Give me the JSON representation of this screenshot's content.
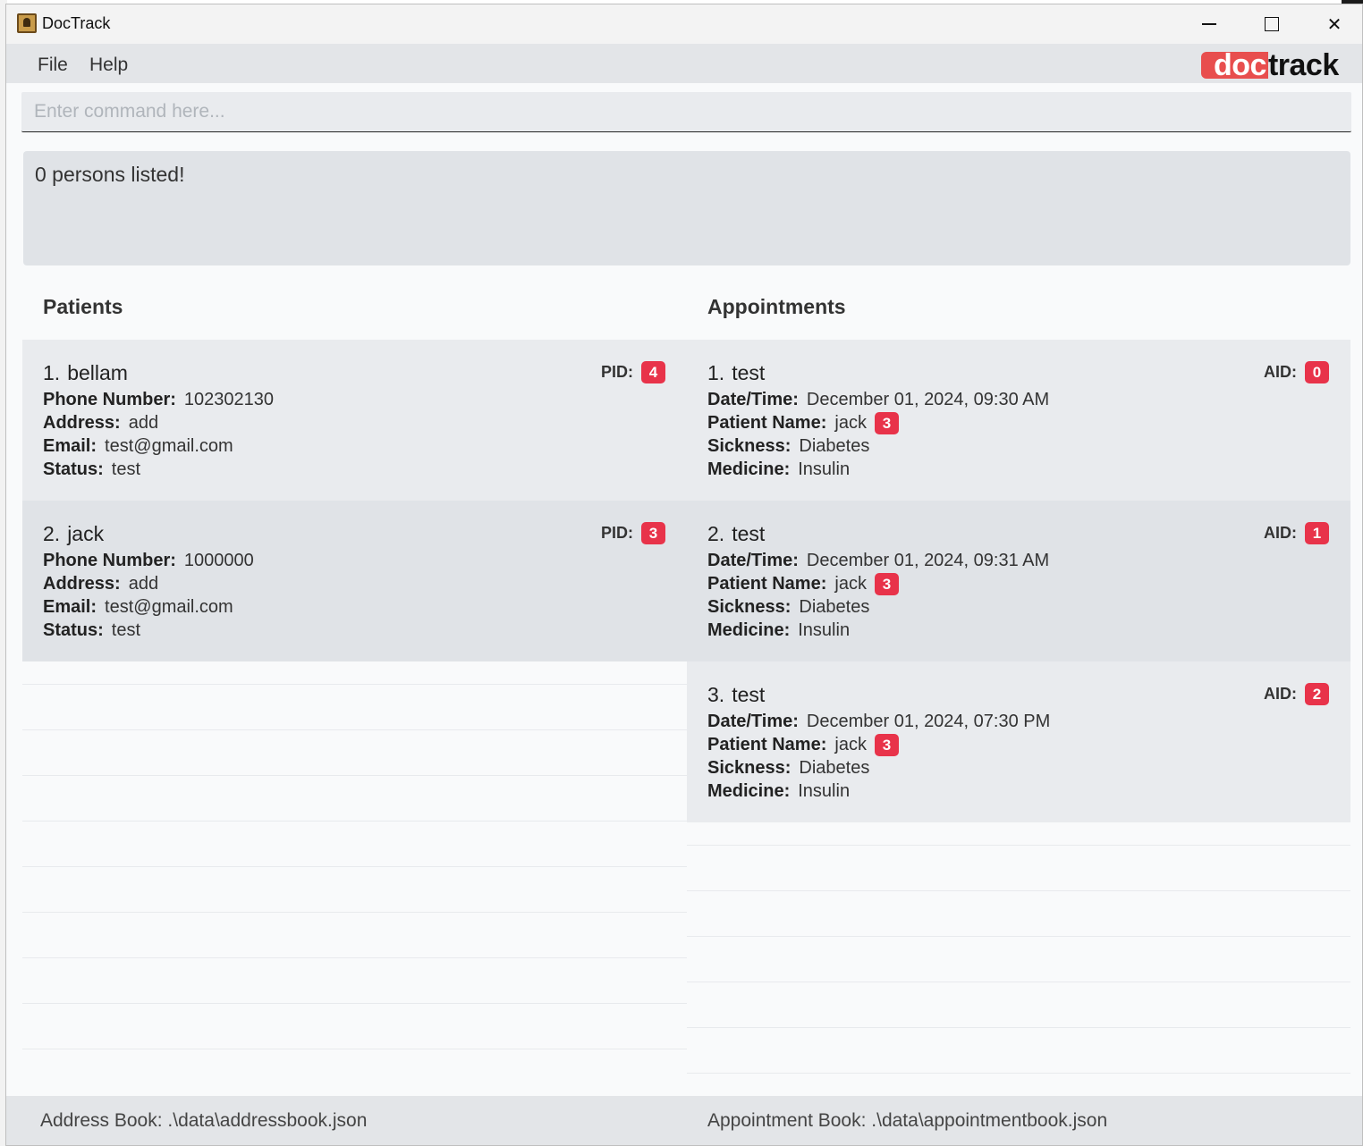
{
  "window": {
    "title": "DocTrack"
  },
  "menu": {
    "file": "File",
    "help": "Help"
  },
  "logo": {
    "part1": "doc",
    "part2": "track"
  },
  "command": {
    "placeholder": "Enter command here..."
  },
  "result": {
    "text": "0 persons listed!"
  },
  "patients": {
    "heading": "Patients",
    "id_label": "PID:",
    "labels": {
      "phone": "Phone Number:",
      "address": "Address:",
      "email": "Email:",
      "status": "Status:"
    },
    "items": [
      {
        "index": "1.",
        "name": "bellam",
        "pid": "4",
        "phone": "102302130",
        "address": "add",
        "email": "test@gmail.com",
        "status": "test"
      },
      {
        "index": "2.",
        "name": "jack",
        "pid": "3",
        "phone": "1000000",
        "address": "add",
        "email": "test@gmail.com",
        "status": "test"
      }
    ]
  },
  "appointments": {
    "heading": "Appointments",
    "id_label": "AID:",
    "labels": {
      "datetime": "Date/Time:",
      "patient": "Patient Name:",
      "sickness": "Sickness:",
      "medicine": "Medicine:"
    },
    "items": [
      {
        "index": "1.",
        "title": "test",
        "aid": "0",
        "datetime": "December 01, 2024, 09:30 AM",
        "patient": "jack",
        "patient_id": "3",
        "sickness": "Diabetes",
        "medicine": "Insulin"
      },
      {
        "index": "2.",
        "title": "test",
        "aid": "1",
        "datetime": "December 01, 2024, 09:31 AM",
        "patient": "jack",
        "patient_id": "3",
        "sickness": "Diabetes",
        "medicine": "Insulin"
      },
      {
        "index": "3.",
        "title": "test",
        "aid": "2",
        "datetime": "December 01, 2024, 07:30 PM",
        "patient": "jack",
        "patient_id": "3",
        "sickness": "Diabetes",
        "medicine": "Insulin"
      }
    ]
  },
  "status": {
    "address_book": "Address Book: .\\data\\addressbook.json",
    "appointment_book": "Appointment Book: .\\data\\appointmentbook.json"
  },
  "colors": {
    "badge": "#e8334a",
    "logo_accent": "#e84e4e"
  }
}
